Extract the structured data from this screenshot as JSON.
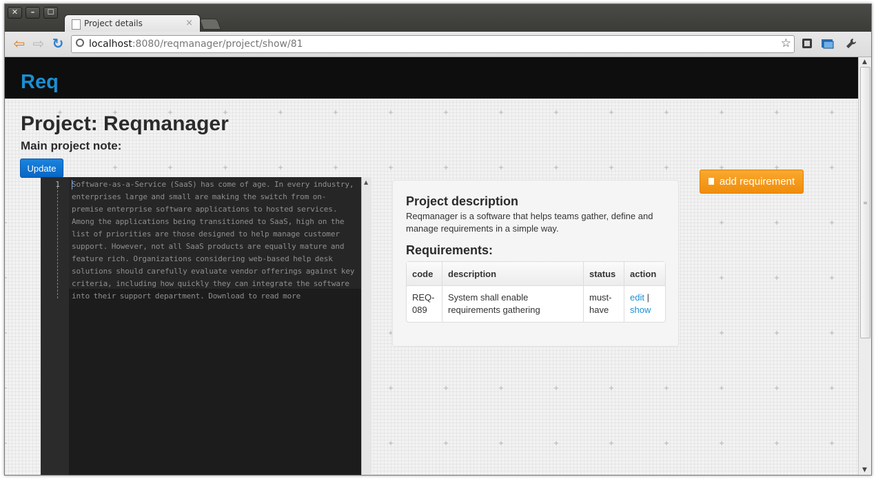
{
  "window": {
    "controls": [
      "✕",
      "–",
      "☐"
    ]
  },
  "tab": {
    "title": "Project details",
    "close": "×"
  },
  "toolbar": {
    "back": "⇦",
    "forward": "⇨",
    "reload": "↻",
    "url_host": "localhost",
    "url_path": ":8080/reqmanager/project/show/81",
    "star": "☆"
  },
  "navbar": {
    "brand": "Req"
  },
  "page": {
    "title": "Project: Reqmanager",
    "note_title": "Main project note:",
    "update_label": "Update"
  },
  "editor": {
    "line_number": "1",
    "text": "Software-as-a-Service (SaaS) has come of age. In every industry, enterprises large and small are making the switch from on-premise enterprise software applications to hosted services. Among the applications being transitioned to SaaS, high on the list of priorities are those designed to help manage customer support. However, not all SaaS products are equally mature and feature rich. Organizations considering web-based help desk solutions should carefully evaluate vendor offerings against key criteria, including how quickly they can integrate the software into their support department. Download to read more"
  },
  "description": {
    "title": "Project description",
    "text": "Reqmanager is a software that helps teams gather, define and manage requirements in a simple way.",
    "requirements_title": "Requirements:"
  },
  "requirements": {
    "columns": [
      "code",
      "description",
      "status",
      "action"
    ],
    "rows": [
      {
        "code": "REQ-089",
        "description": "System shall enable requirements gathering",
        "status": "must-have",
        "edit": "edit",
        "separator": "|",
        "show": "show"
      }
    ]
  },
  "actions": {
    "add_requirement": "add requirement"
  },
  "colors": {
    "brand": "#1a8fd1",
    "primary_button": "#0766c4",
    "warning_button": "#f08c0a",
    "navbar": "#0e0e0e",
    "editor_bg": "#1c1c1c"
  }
}
